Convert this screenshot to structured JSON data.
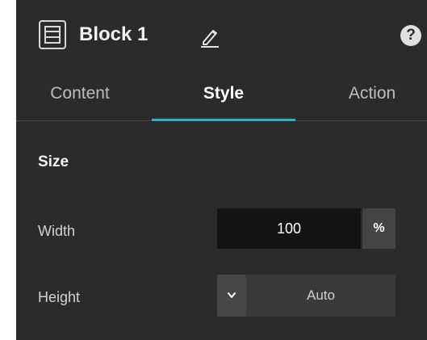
{
  "header": {
    "title": "Block 1",
    "block_icon": "block-layout-icon",
    "edit_icon": "pencil-icon",
    "help_icon": "question-circle-icon",
    "help_symbol": "?"
  },
  "tabs": [
    {
      "label": "Content",
      "active": false
    },
    {
      "label": "Style",
      "active": true
    },
    {
      "label": "Action",
      "active": false
    }
  ],
  "size": {
    "section_title": "Size",
    "width": {
      "label": "Width",
      "value": "100",
      "unit": "%"
    },
    "height": {
      "label": "Height",
      "value": "Auto",
      "toggle_icon": "chevron-down-icon"
    }
  },
  "colors": {
    "panel_bg": "#2b2b2b",
    "active_tab_accent": "#2bb3c0",
    "input_bg": "#141414"
  }
}
